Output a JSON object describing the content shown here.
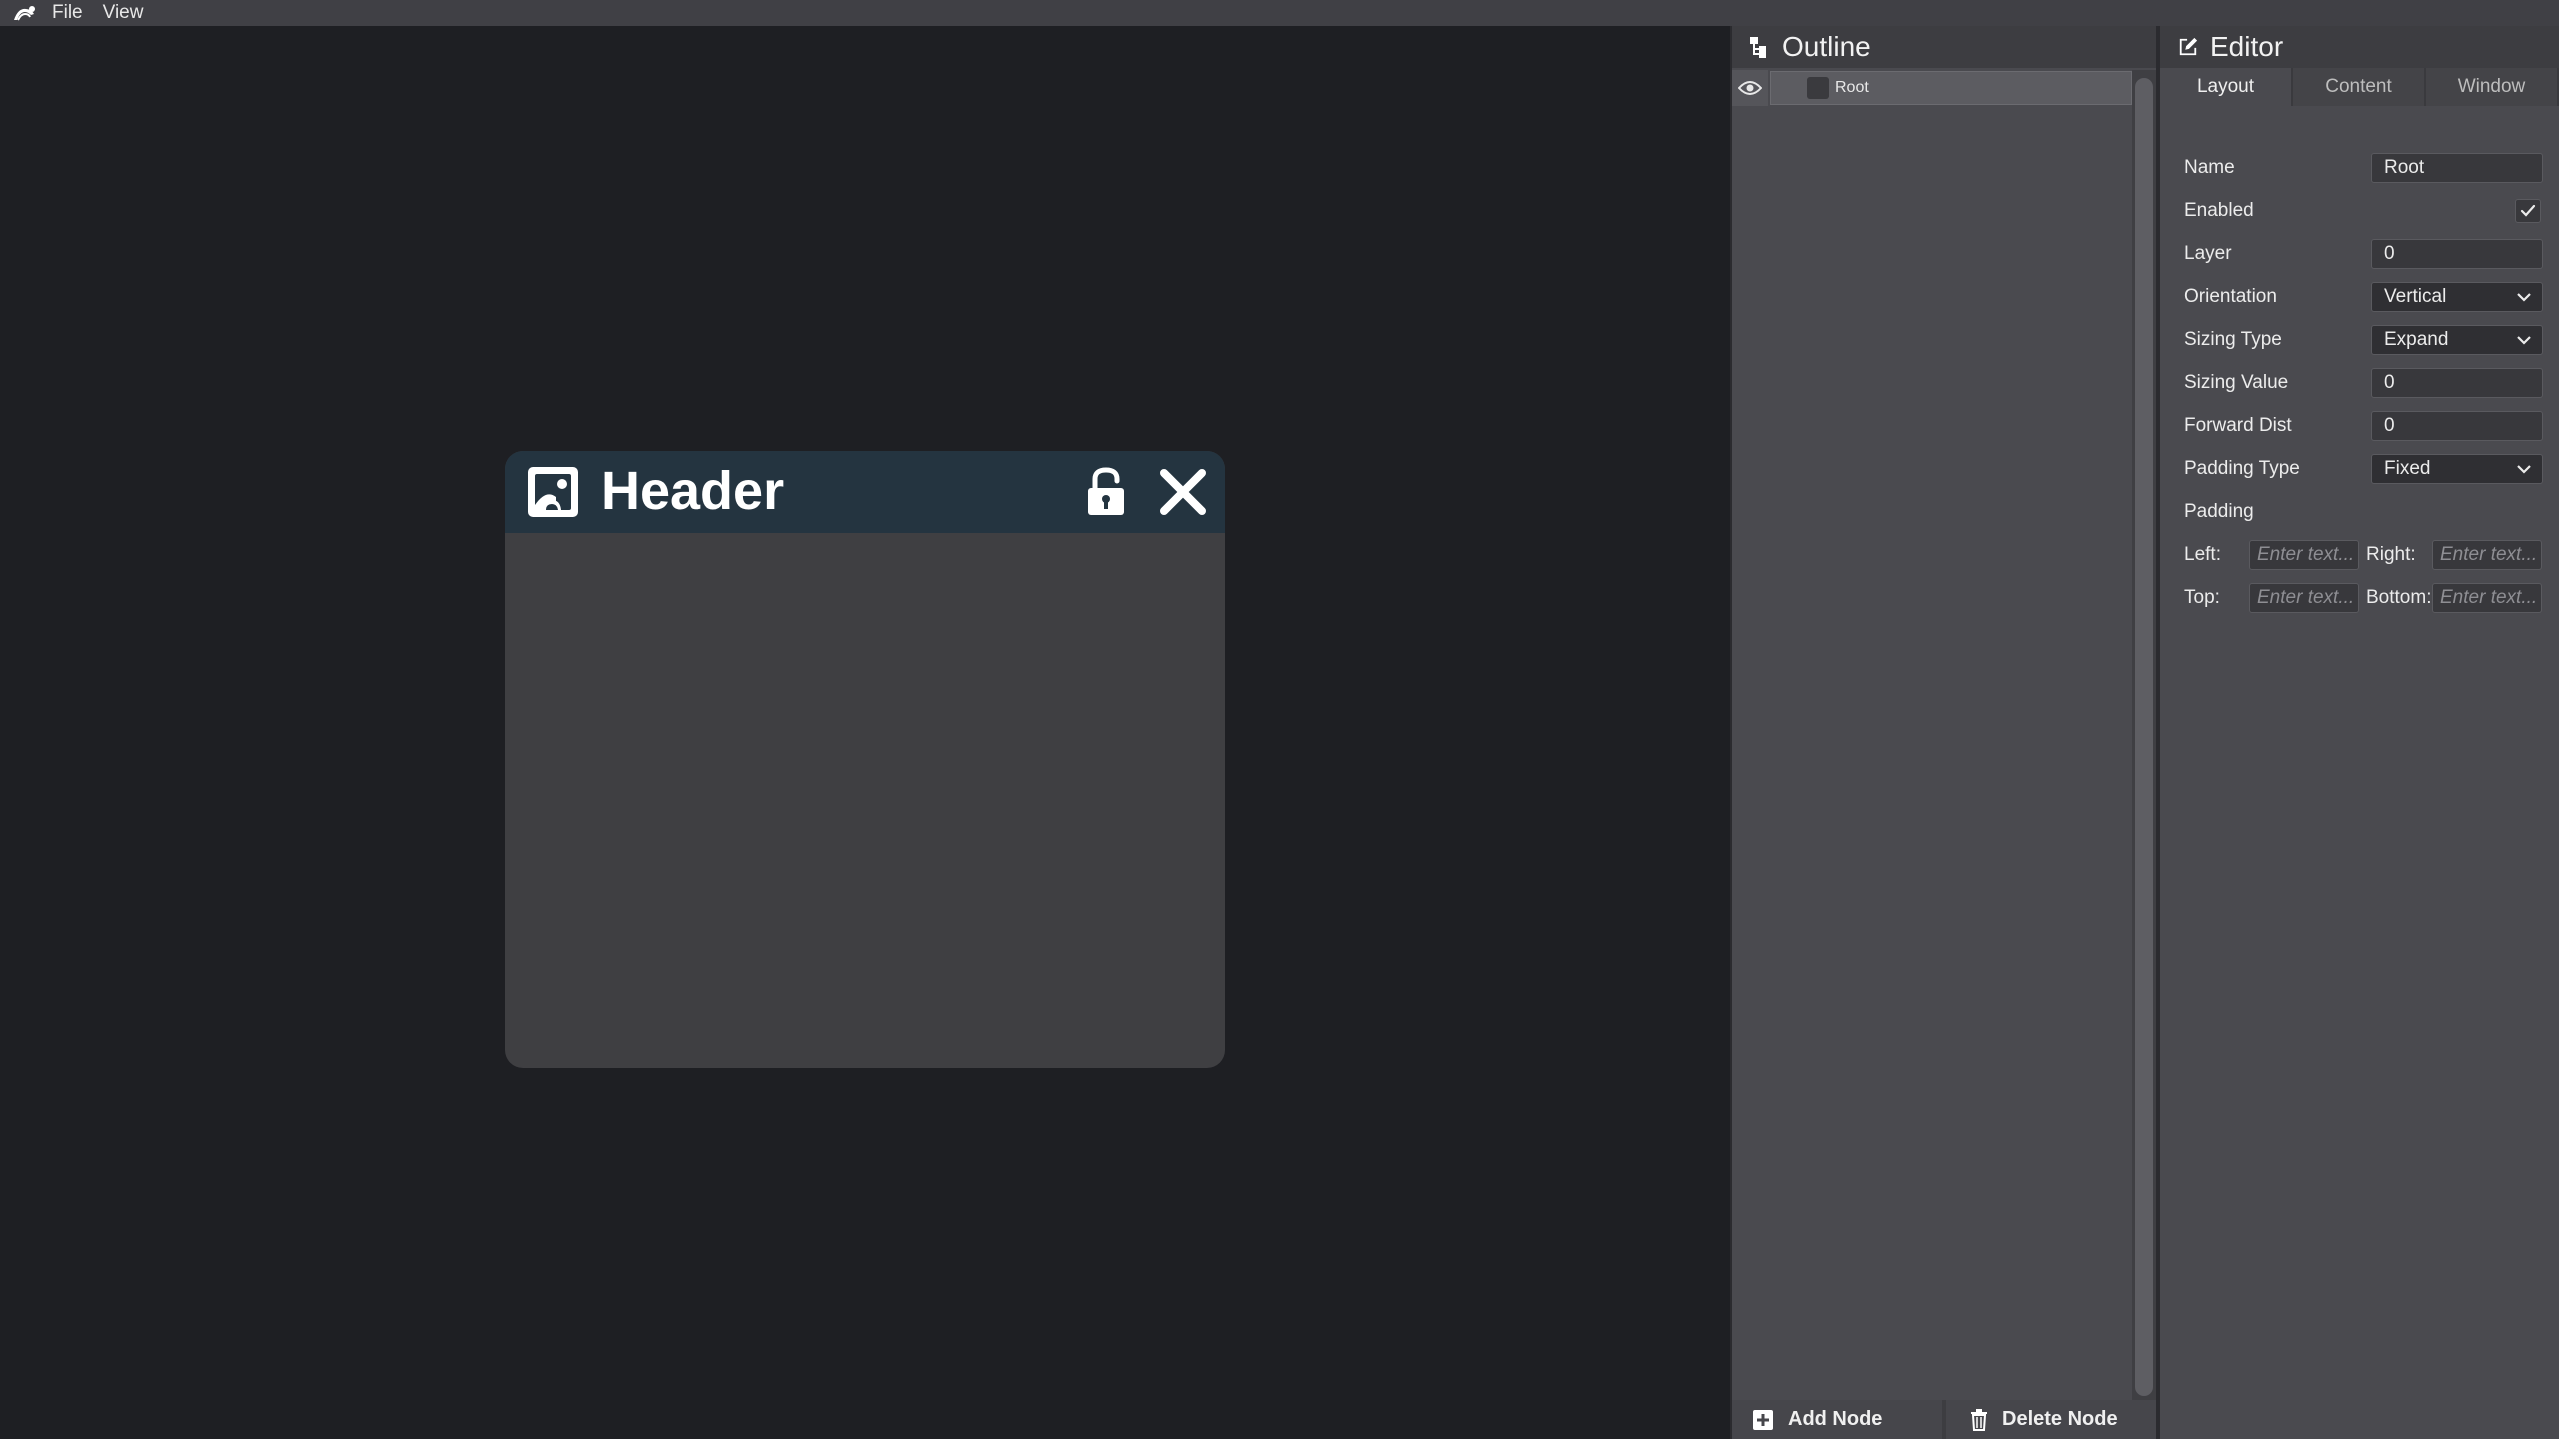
{
  "menubar": {
    "items": [
      "File",
      "View"
    ]
  },
  "floating_window": {
    "title": "Header",
    "icons": [
      "image-icon",
      "unlock-icon",
      "close-icon"
    ]
  },
  "outline": {
    "title": "Outline",
    "tree": [
      {
        "label": "Root"
      }
    ],
    "add_label": "Add Node",
    "delete_label": "Delete Node"
  },
  "editor": {
    "title": "Editor",
    "tabs": [
      "Layout",
      "Content",
      "Window"
    ],
    "active_tab": "Layout",
    "fields": {
      "name": {
        "label": "Name",
        "value": "Root"
      },
      "enabled": {
        "label": "Enabled",
        "checked": true
      },
      "layer": {
        "label": "Layer",
        "value": "0"
      },
      "orientation": {
        "label": "Orientation",
        "value": "Vertical"
      },
      "sizing_type": {
        "label": "Sizing Type",
        "value": "Expand"
      },
      "sizing_value": {
        "label": "Sizing Value",
        "value": "0"
      },
      "forward_dist": {
        "label": "Forward Dist",
        "value": "0"
      },
      "padding_type": {
        "label": "Padding Type",
        "value": "Fixed"
      },
      "padding": {
        "label": "Padding"
      }
    },
    "padding": {
      "left_label": "Left:",
      "right_label": "Right:",
      "top_label": "Top:",
      "bottom_label": "Bottom:",
      "placeholder": "Enter text..."
    }
  },
  "colors": {
    "canvas_bg": "#1e1f23",
    "window_header": "#243440",
    "window_body": "#3f3f42",
    "panel_bg": "#4a4a4f"
  }
}
